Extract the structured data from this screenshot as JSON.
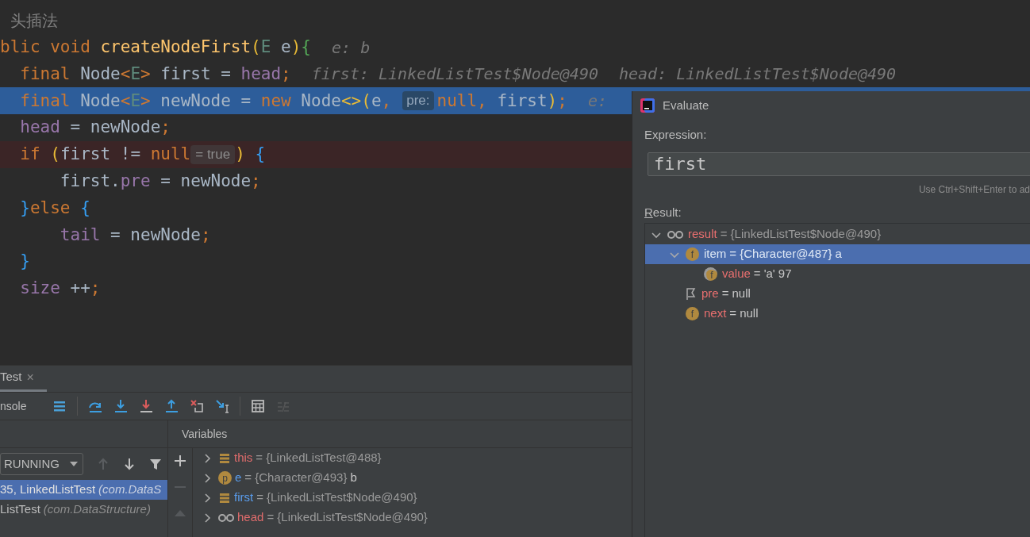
{
  "editor": {
    "lines": [
      {
        "kind": "comment",
        "executing": false,
        "breakpoint": false,
        "text": "头插法"
      },
      {
        "kind": "code",
        "executing": false,
        "breakpoint": false,
        "segments": [
          {
            "kind": "code",
            "tokens": [
              {
                "text": "blic",
                "kind": "keyword"
              },
              {
                "text": " void",
                "kind": "keyword"
              },
              {
                "text": " createNodeFirst",
                "kind": "method"
              },
              {
                "text": "(",
                "kind": "bracket_yellow"
              },
              {
                "text": "E",
                "kind": "typeparam"
              },
              {
                "text": " e",
                "kind": "plain"
              },
              {
                "text": ")",
                "kind": "bracket_yellow"
              },
              {
                "text": "{",
                "kind": "bracket_green"
              }
            ]
          },
          {
            "kind": "hint",
            "text": "e: b"
          }
        ]
      },
      {
        "kind": "code",
        "executing": false,
        "breakpoint": false,
        "segments": [
          {
            "kind": "code",
            "tokens": [
              {
                "text": "  final",
                "kind": "keyword"
              },
              {
                "text": " Node",
                "kind": "plain"
              },
              {
                "text": "<",
                "kind": "keyword"
              },
              {
                "text": "E",
                "kind": "typeparam"
              },
              {
                "text": ">",
                "kind": "keyword"
              },
              {
                "text": " first = ",
                "kind": "plain"
              },
              {
                "text": "head",
                "kind": "field"
              },
              {
                "text": ";",
                "kind": "keyword"
              }
            ]
          },
          {
            "kind": "hint",
            "text": "first: LinkedListTest$Node@490"
          },
          {
            "kind": "hint",
            "text": "head: LinkedListTest$Node@490"
          }
        ]
      },
      {
        "kind": "code",
        "executing": true,
        "breakpoint": false,
        "segments": [
          {
            "kind": "code",
            "tokens": [
              {
                "text": "  final",
                "kind": "keyword"
              },
              {
                "text": " Node",
                "kind": "plain"
              },
              {
                "text": "<",
                "kind": "keyword"
              },
              {
                "text": "E",
                "kind": "typeparam"
              },
              {
                "text": ">",
                "kind": "keyword"
              },
              {
                "text": " newNode = ",
                "kind": "plain"
              },
              {
                "text": "new",
                "kind": "keyword"
              },
              {
                "text": " Node",
                "kind": "plain"
              },
              {
                "text": "<>",
                "kind": "bracket_yellow"
              },
              {
                "text": "(",
                "kind": "bracket_yellow"
              },
              {
                "text": "e",
                "kind": "plain"
              },
              {
                "text": ",",
                "kind": "keyword"
              }
            ]
          },
          {
            "kind": "param_hint",
            "text": "pre:"
          },
          {
            "kind": "code",
            "tokens": [
              {
                "text": "null",
                "kind": "keyword"
              },
              {
                "text": ",",
                "kind": "keyword"
              },
              {
                "text": " first",
                "kind": "plain"
              },
              {
                "text": ")",
                "kind": "bracket_yellow"
              },
              {
                "text": ";",
                "kind": "keyword"
              }
            ]
          },
          {
            "kind": "hint",
            "text": "e:"
          }
        ]
      },
      {
        "kind": "code",
        "executing": false,
        "breakpoint": false,
        "segments": [
          {
            "kind": "code",
            "tokens": [
              {
                "text": "  head",
                "kind": "field"
              },
              {
                "text": " = newNode",
                "kind": "plain"
              },
              {
                "text": ";",
                "kind": "keyword"
              }
            ]
          }
        ]
      },
      {
        "kind": "code",
        "executing": false,
        "breakpoint": true,
        "segments": [
          {
            "kind": "code",
            "tokens": [
              {
                "text": "  if",
                "kind": "keyword"
              },
              {
                "text": " (",
                "kind": "bracket_yellow"
              },
              {
                "text": "first != ",
                "kind": "plain"
              },
              {
                "text": "null",
                "kind": "keyword"
              }
            ]
          },
          {
            "kind": "value_hint",
            "text": "= true"
          },
          {
            "kind": "code",
            "tokens": [
              {
                "text": ")",
                "kind": "bracket_yellow"
              },
              {
                "text": " {",
                "kind": "bracket_blue"
              }
            ]
          }
        ]
      },
      {
        "kind": "code",
        "executing": false,
        "breakpoint": false,
        "segments": [
          {
            "kind": "code",
            "tokens": [
              {
                "text": "      first.",
                "kind": "plain"
              },
              {
                "text": "pre",
                "kind": "field"
              },
              {
                "text": " = newNode",
                "kind": "plain"
              },
              {
                "text": ";",
                "kind": "keyword"
              }
            ]
          }
        ]
      },
      {
        "kind": "code",
        "executing": false,
        "breakpoint": false,
        "segments": [
          {
            "kind": "code",
            "tokens": [
              {
                "text": "  }",
                "kind": "bracket_blue"
              },
              {
                "text": "else",
                "kind": "keyword"
              },
              {
                "text": " {",
                "kind": "bracket_blue"
              }
            ]
          }
        ]
      },
      {
        "kind": "code",
        "executing": false,
        "breakpoint": false,
        "segments": [
          {
            "kind": "code",
            "tokens": [
              {
                "text": "      tail",
                "kind": "field"
              },
              {
                "text": " = newNode",
                "kind": "plain"
              },
              {
                "text": ";",
                "kind": "keyword"
              }
            ]
          }
        ]
      },
      {
        "kind": "code",
        "executing": false,
        "breakpoint": false,
        "segments": [
          {
            "kind": "code",
            "tokens": [
              {
                "text": "  }",
                "kind": "bracket_blue"
              }
            ]
          }
        ]
      },
      {
        "kind": "code",
        "executing": false,
        "breakpoint": false,
        "segments": [
          {
            "kind": "code",
            "tokens": [
              {
                "text": "  size",
                "kind": "field"
              },
              {
                "text": " ++",
                "kind": "plain"
              },
              {
                "text": ";",
                "kind": "keyword"
              }
            ]
          }
        ]
      }
    ]
  },
  "debug_panel": {
    "tabs": [
      {
        "label": "Test",
        "close": "×",
        "selected": true
      }
    ],
    "toolbar": {
      "console_tab": "nsole",
      "buttons": [
        {
          "kind": "layout",
          "disabled": false
        },
        {
          "kind": "step_over",
          "disabled": false
        },
        {
          "kind": "step_into",
          "disabled": false
        },
        {
          "kind": "force_step_into",
          "disabled": false
        },
        {
          "kind": "step_out",
          "disabled": false
        },
        {
          "kind": "drop_frame",
          "disabled": false
        },
        {
          "kind": "run_to_cursor",
          "disabled": false
        },
        {
          "kind": "evaluate",
          "disabled": false
        },
        {
          "kind": "trace",
          "disabled": true
        }
      ]
    },
    "frames": {
      "thread": "RUNNING",
      "nav": [
        {
          "kind": "up",
          "disabled": true
        },
        {
          "kind": "down",
          "disabled": false
        },
        {
          "kind": "filter",
          "disabled": false
        }
      ],
      "items": [
        {
          "location": "35, LinkedListTest",
          "package": "(com.DataS",
          "selected": true
        },
        {
          "location": "ListTest",
          "package": "(com.DataStructure)",
          "selected": false
        }
      ]
    },
    "variables": {
      "title": "Variables",
      "side_buttons": [
        {
          "kind": "add",
          "disabled": false
        },
        {
          "kind": "remove",
          "disabled": true
        },
        {
          "kind": "move_up",
          "disabled": true
        }
      ],
      "items": [
        {
          "name": "this",
          "color": "#e06c6c",
          "icon": {
            "kind": "stack"
          },
          "ref": "= {LinkedListTest@488}",
          "expanded": false
        },
        {
          "name": "e",
          "color": "#5a9ded",
          "icon": {
            "kind": "letter",
            "text": "p",
            "final": false
          },
          "ref": "= {Character@493}",
          "shown": "b",
          "expanded": false
        },
        {
          "name": "first",
          "color": "#5a9ded",
          "icon": {
            "kind": "stack"
          },
          "ref": "= {LinkedListTest$Node@490}",
          "expanded": false
        },
        {
          "name": "head",
          "color": "#e06c6c",
          "icon": {
            "kind": "watch"
          },
          "ref": "= {LinkedListTest$Node@490}",
          "expanded": false
        }
      ]
    }
  },
  "evaluate_dialog": {
    "title": "Evaluate",
    "expression_label": "Expression:",
    "expression": "first",
    "hint": "Use Ctrl+Shift+Enter to ad",
    "result_label": "Result:",
    "result": [
      {
        "name": "result",
        "icon": {
          "kind": "watch"
        },
        "ref": "= {LinkedListTest$Node@490}",
        "expanded": true,
        "selected": false,
        "children": [
          {
            "name": "item",
            "icon": {
              "kind": "letter",
              "text": "f",
              "final": false
            },
            "ref": "= {Character@487}",
            "shown": "a",
            "expanded": true,
            "selected": true,
            "children": [
              {
                "name": "value",
                "icon": {
                  "kind": "letter",
                  "text": "f",
                  "final": true
                },
                "ref": "=",
                "shown": "'a' 97",
                "selected": false
              }
            ]
          },
          {
            "name": "pre",
            "icon": {
              "kind": "flag"
            },
            "ref": "=",
            "shown": "null",
            "selected": false
          },
          {
            "name": "next",
            "icon": {
              "kind": "letter",
              "text": "f",
              "final": false
            },
            "ref": "=",
            "shown": "null",
            "selected": false
          }
        ]
      }
    ]
  }
}
